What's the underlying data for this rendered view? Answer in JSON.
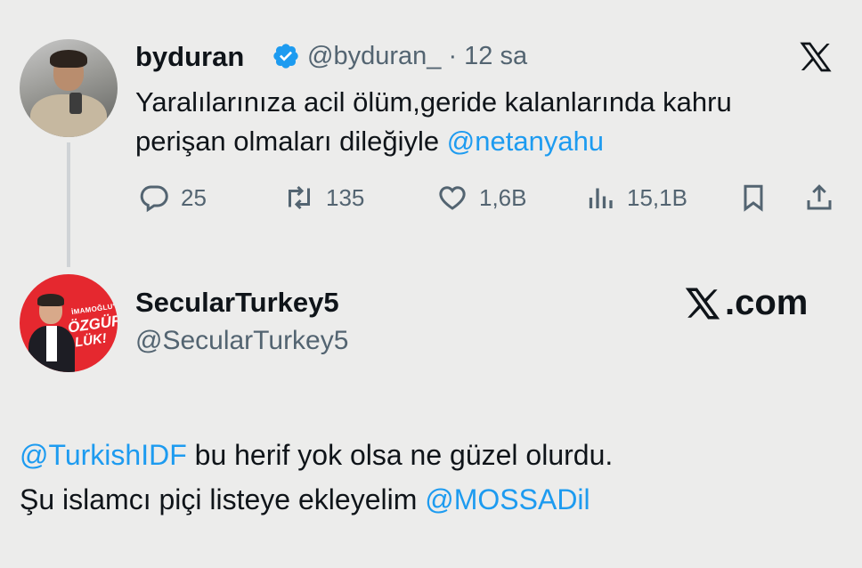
{
  "tweet1": {
    "display_name": "byduran",
    "handle": "@byduran_",
    "separator": "·",
    "time": "12 sa",
    "text_before": "Yaralılarınıza acil ölüm,geride kalanlarında kahru perişan olmaları dileğiyle ",
    "mention": "@netanyahu",
    "actions": {
      "replies": "25",
      "retweets": "135",
      "likes": "1,6B",
      "views": "15,1B"
    },
    "icons": [
      "verified-badge-icon",
      "x-logo-icon",
      "reply-icon",
      "retweet-icon",
      "like-icon",
      "views-icon",
      "bookmark-icon",
      "share-icon"
    ]
  },
  "tweet2": {
    "display_name": "SecularTurkey5",
    "handle": "@SecularTurkey5",
    "brand": ".com",
    "avatar_text": {
      "line1": "İMAMOĞLU'NA",
      "line2": "ÖZGÜR-",
      "line3": "LÜK!"
    },
    "mention1": "@TurkishIDF",
    "text_line1": " bu herif yok olsa ne güzel olurdu.",
    "text_line2": "Şu islamcı piçi listeye ekleyelim ",
    "mention2": "@MOSSADil"
  },
  "colors": {
    "accent": "#1d9bf0",
    "muted": "#536471",
    "background": "#ececeb"
  }
}
